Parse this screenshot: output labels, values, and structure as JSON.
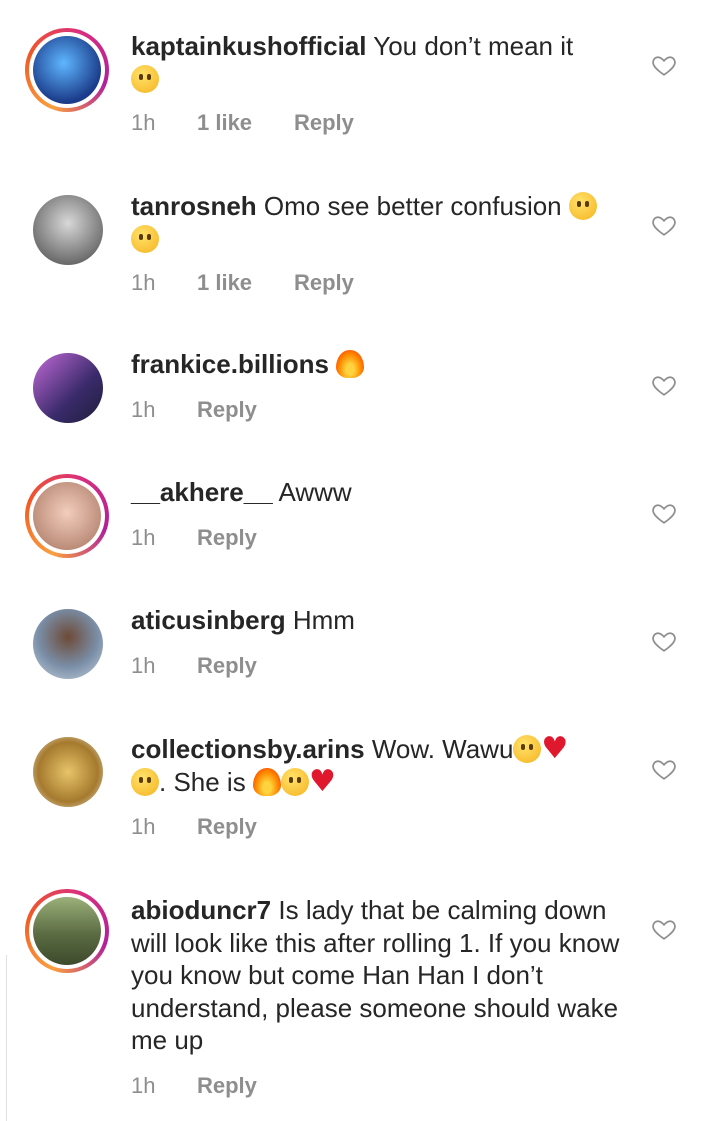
{
  "comments": [
    {
      "user": "kaptainkushofficial",
      "text": "You don’t mean it",
      "time": "1h",
      "likes": "1 like",
      "reply": "Reply",
      "story": true,
      "avatar_color": "#1b3c8a"
    },
    {
      "user": "tanrosneh",
      "text": "Omo see better confusion",
      "time": "1h",
      "likes": "1 like",
      "reply": "Reply",
      "story": false,
      "avatar_color": "#9a9a9a"
    },
    {
      "user": "frankice.billions",
      "text": "",
      "time": "1h",
      "likes": "",
      "reply": "Reply",
      "story": false,
      "avatar_color": "#6b4fa0"
    },
    {
      "user": "__akhere__",
      "text": "Awww",
      "time": "1h",
      "likes": "",
      "reply": "Reply",
      "story": true,
      "avatar_color": "#e9b9a4"
    },
    {
      "user": "aticusinberg",
      "text": "Hmm",
      "time": "1h",
      "likes": "",
      "reply": "Reply",
      "story": false,
      "avatar_color": "#7a8fa8"
    },
    {
      "user": "collectionsby.arins",
      "text": "Wow. Wawu",
      "text_2": ". She is",
      "time": "1h",
      "likes": "",
      "reply": "Reply",
      "story": false,
      "avatar_color": "#c79a3d"
    },
    {
      "user": "abioduncr7",
      "text": "Is lady that be calming down will look like this after rolling 1. If you know you know but come Han Han I don’t understand, please someone should wake me up",
      "time": "1h",
      "likes": "",
      "reply": "Reply",
      "story": true,
      "avatar_color": "#6e7f5a"
    }
  ],
  "icons": {
    "like": "heart-outline-icon"
  }
}
